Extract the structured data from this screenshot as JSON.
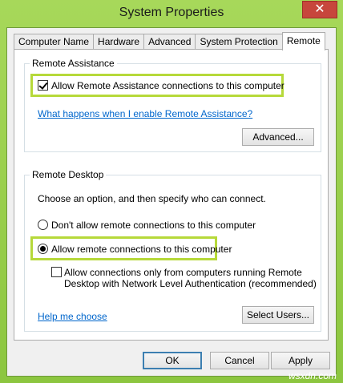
{
  "window": {
    "title": "System Properties",
    "close_label": "✕"
  },
  "tabs": [
    {
      "label": "Computer Name",
      "active": false
    },
    {
      "label": "Hardware",
      "active": false
    },
    {
      "label": "Advanced",
      "active": false
    },
    {
      "label": "System Protection",
      "active": false
    },
    {
      "label": "Remote",
      "active": true
    }
  ],
  "remote_assistance": {
    "group_label": "Remote Assistance",
    "allow_checkbox_label": "Allow Remote Assistance connections to this computer",
    "allow_checked": true,
    "help_link": "What happens when I enable Remote Assistance?",
    "advanced_button": "Advanced..."
  },
  "remote_desktop": {
    "group_label": "Remote Desktop",
    "intro": "Choose an option, and then specify who can connect.",
    "option_deny": "Don't allow remote connections to this computer",
    "option_allow": "Allow remote connections to this computer",
    "selected": "allow",
    "nla_label_line1": "Allow connections only from computers running Remote",
    "nla_label_line2": "Desktop with Network Level Authentication (recommended)",
    "nla_checked": false,
    "help_link": "Help me choose",
    "select_users_button": "Select Users..."
  },
  "footer": {
    "ok": "OK",
    "cancel": "Cancel",
    "apply": "Apply"
  },
  "watermark": "wsxdn.com"
}
